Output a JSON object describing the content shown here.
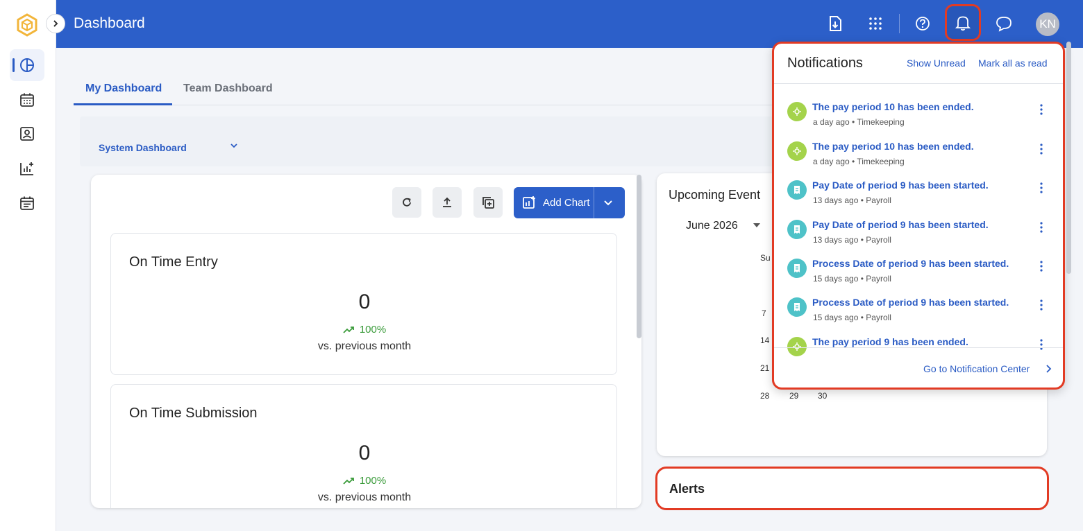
{
  "app": {
    "title": "Dashboard",
    "user_initials": "KN"
  },
  "tabs": [
    {
      "label": "My Dashboard"
    },
    {
      "label": "Team Dashboard"
    }
  ],
  "dashboard_selector": {
    "value": "System Dashboard"
  },
  "toolbar": {
    "add_chart_label": "Add Chart"
  },
  "cards": [
    {
      "title": "On Time Entry",
      "value": "0",
      "change": "100%",
      "comparison": "vs. previous month"
    },
    {
      "title": "On Time Submission",
      "value": "0",
      "change": "100%",
      "comparison": "vs. previous month"
    }
  ],
  "event": {
    "title": "Upcoming Event",
    "month": "June 2026",
    "weekday_fragment": "Su",
    "days": [
      "7",
      "14",
      "21",
      "28",
      "29",
      "30"
    ]
  },
  "alerts": {
    "title": "Alerts"
  },
  "notifications": {
    "title": "Notifications",
    "show_unread": "Show Unread",
    "mark_all_read": "Mark all as read",
    "items": [
      {
        "title": "The pay period 10 has been ended.",
        "time": "a day ago",
        "source": "Timekeeping",
        "kind": "green"
      },
      {
        "title": "The pay period 10 has been ended.",
        "time": "a day ago",
        "source": "Timekeeping",
        "kind": "green"
      },
      {
        "title": "Pay Date of period 9 has been started.",
        "time": "13 days ago",
        "source": "Payroll",
        "kind": "teal"
      },
      {
        "title": "Pay Date of period 9 has been started.",
        "time": "13 days ago",
        "source": "Payroll",
        "kind": "teal"
      },
      {
        "title": "Process Date of period 9 has been started.",
        "time": "15 days ago",
        "source": "Payroll",
        "kind": "teal"
      },
      {
        "title": "Process Date of period 9 has been started.",
        "time": "15 days ago",
        "source": "Payroll",
        "kind": "teal"
      },
      {
        "title": "The pay period 9 has been ended.",
        "time": "",
        "source": "",
        "kind": "green"
      }
    ],
    "footer_link": "Go to Notification Center"
  },
  "colors": {
    "brand": "#2c5fc9",
    "highlight": "#e23b24",
    "positive": "#3a9b3a"
  },
  "icons": {
    "rail": [
      "pie-chart-icon",
      "calendar-icon",
      "contact-card-icon",
      "analytics-add-icon",
      "schedule-icon"
    ],
    "topbar": [
      "download-doc-icon",
      "apps-grid-icon",
      "help-icon",
      "bell-icon",
      "chat-icon"
    ]
  }
}
